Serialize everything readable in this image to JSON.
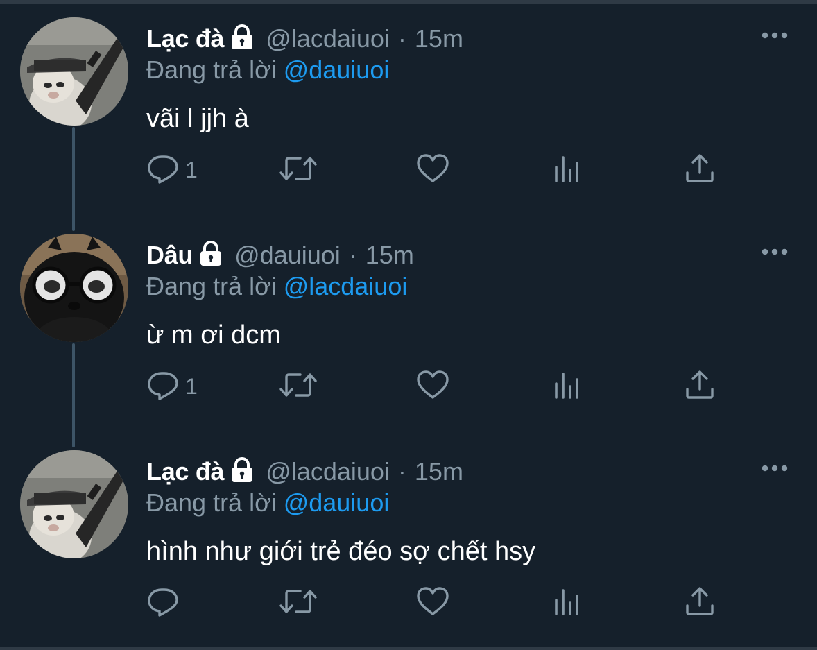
{
  "tweets": [
    {
      "display_name": "Lạc đà",
      "handle": "@lacdaiuoi",
      "separator": "·",
      "time": "15m",
      "reply_prefix": "Đang trả lời",
      "reply_to": "@dauiuoi",
      "text": "vãi l jjh à",
      "reply_count": "1",
      "avatar": "camel-plush-avatar"
    },
    {
      "display_name": "Dâu",
      "handle": "@dauiuoi",
      "separator": "·",
      "time": "15m",
      "reply_prefix": "Đang trả lời",
      "reply_to": "@lacdaiuoi",
      "text": "ừ m ơi dcm",
      "reply_count": "1",
      "avatar": "black-plush-glasses-avatar"
    },
    {
      "display_name": "Lạc đà",
      "handle": "@lacdaiuoi",
      "separator": "·",
      "time": "15m",
      "reply_prefix": "Đang trả lời",
      "reply_to": "@dauiuoi",
      "text": "hình như giới trẻ đéo sợ chết hsy",
      "reply_count": "",
      "avatar": "camel-plush-avatar"
    }
  ],
  "icons": {
    "protected": "lock-icon",
    "more": "more-icon",
    "reply": "reply-icon",
    "retweet": "retweet-icon",
    "like": "heart-icon",
    "analytics": "analytics-icon",
    "share": "share-icon"
  },
  "colors": {
    "background": "#15202b",
    "secondary_text": "#8899a6",
    "link": "#1d9bf0",
    "thread_line": "#3d5466"
  }
}
